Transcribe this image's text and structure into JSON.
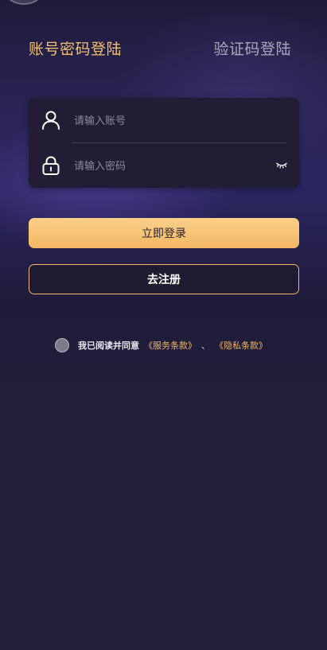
{
  "tabs": {
    "active": "账号密码登陆",
    "inactive": "验证码登陆"
  },
  "form": {
    "account_placeholder": "请输入账号",
    "password_placeholder": "请输入密码",
    "account_icon": "user-icon",
    "password_icon": "lock-icon",
    "toggle_icon": "eye-closed-icon"
  },
  "buttons": {
    "login": "立即登录",
    "register": "去注册"
  },
  "agreement": {
    "text": "我已阅读并同意",
    "service_link": "《服务条款》",
    "separator": "、",
    "privacy_link": "《隐私条款》"
  },
  "colors": {
    "accent": "#f2bf72",
    "background": "#22203a",
    "button_gradient_top": "#fbd08a",
    "button_gradient_bottom": "#f4b765"
  }
}
